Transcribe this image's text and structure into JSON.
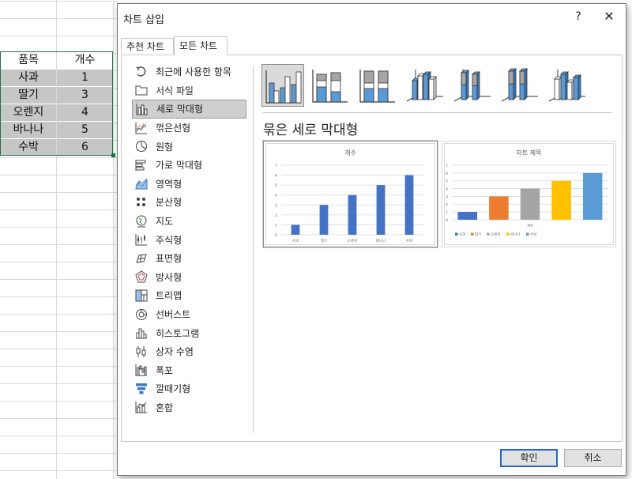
{
  "sheet": {
    "headers": [
      "품목",
      "개수"
    ],
    "rows": [
      [
        "사과",
        "1"
      ],
      [
        "딸기",
        "3"
      ],
      [
        "오렌지",
        "4"
      ],
      [
        "바나나",
        "5"
      ],
      [
        "수박",
        "6"
      ]
    ]
  },
  "dialog": {
    "title": "차트 삽입",
    "help_label": "?",
    "close_label": "✕",
    "tabs": [
      {
        "label": "추천 차트",
        "active": false
      },
      {
        "label": "모든 차트",
        "active": true
      }
    ],
    "categories": [
      {
        "label": "최근에 사용한 항목",
        "icon": "recent-icon"
      },
      {
        "label": "서식 파일",
        "icon": "template-folder-icon"
      },
      {
        "label": "세로 막대형",
        "icon": "column-chart-icon",
        "selected": true
      },
      {
        "label": "꺾은선형",
        "icon": "line-chart-icon"
      },
      {
        "label": "원형",
        "icon": "pie-chart-icon"
      },
      {
        "label": "가로 막대형",
        "icon": "bar-chart-icon"
      },
      {
        "label": "영역형",
        "icon": "area-chart-icon"
      },
      {
        "label": "분산형",
        "icon": "scatter-chart-icon"
      },
      {
        "label": "지도",
        "icon": "map-chart-icon"
      },
      {
        "label": "주식형",
        "icon": "stock-chart-icon"
      },
      {
        "label": "표면형",
        "icon": "surface-chart-icon"
      },
      {
        "label": "방사형",
        "icon": "radar-chart-icon"
      },
      {
        "label": "트리맵",
        "icon": "treemap-chart-icon"
      },
      {
        "label": "선버스트",
        "icon": "sunburst-chart-icon"
      },
      {
        "label": "히스토그램",
        "icon": "histogram-chart-icon"
      },
      {
        "label": "상자 수염",
        "icon": "box-whisker-chart-icon"
      },
      {
        "label": "폭포",
        "icon": "waterfall-chart-icon"
      },
      {
        "label": "깔때기형",
        "icon": "funnel-chart-icon"
      },
      {
        "label": "혼합",
        "icon": "combo-chart-icon"
      }
    ],
    "subtypes": [
      {
        "icon": "clustered-column-icon",
        "selected": true
      },
      {
        "icon": "stacked-column-icon"
      },
      {
        "icon": "percent-stacked-column-icon"
      },
      {
        "icon": "3d-clustered-column-icon"
      },
      {
        "icon": "3d-stacked-column-icon"
      },
      {
        "icon": "3d-percent-stacked-column-icon"
      },
      {
        "icon": "3d-column-icon"
      }
    ],
    "selected_subtype_name": "묶은 세로 막대형",
    "preview1": {
      "title": "개수",
      "color": "#4472c4"
    },
    "preview2": {
      "title": "차트 제목",
      "xlabel": "개수",
      "colors": [
        "#4472c4",
        "#ed7d31",
        "#a5a5a5",
        "#ffc000",
        "#5b9bd5"
      ]
    },
    "ok_label": "확인",
    "cancel_label": "취소"
  },
  "chart_data": [
    {
      "type": "bar",
      "title": "개수",
      "categories": [
        "사과",
        "딸기",
        "오렌지",
        "바나나",
        "수박"
      ],
      "values": [
        1,
        3,
        4,
        5,
        6
      ],
      "ylim": [
        0,
        7
      ],
      "yticks": [
        "0",
        "1",
        "2",
        "3",
        "4",
        "5",
        "6",
        "7"
      ],
      "grid": true,
      "legend": "none"
    },
    {
      "type": "bar",
      "title": "차트 제목",
      "xlabel": "개수",
      "categories": [
        "사과",
        "딸기",
        "오렌지",
        "바나나",
        "수박"
      ],
      "values": [
        1,
        3,
        4,
        5,
        6
      ],
      "ylim": [
        0,
        7
      ],
      "yticks": [
        "0",
        "1",
        "2",
        "3",
        "4",
        "5",
        "6",
        "7"
      ],
      "grid": true,
      "legend": "bottom"
    }
  ]
}
